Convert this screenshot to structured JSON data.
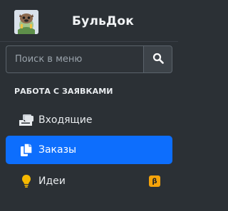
{
  "brand": {
    "name": "БульДок",
    "logo_icon": "bulldog-logo-icon"
  },
  "search": {
    "placeholder": "Поиск в меню",
    "value": "",
    "button_icon": "search-icon"
  },
  "section": {
    "heading": "РАБОТА С ЗАЯВКАМИ"
  },
  "nav": {
    "items": [
      {
        "label": "Входящие",
        "icon": "inbox-stack-icon",
        "active": false
      },
      {
        "label": "Заказы",
        "icon": "documents-icon",
        "active": true
      },
      {
        "label": "Идеи",
        "icon": "lightbulb-icon",
        "active": false,
        "badge": "β"
      }
    ]
  },
  "colors": {
    "sidebar_bg": "#2b3035",
    "active_bg": "#0d6efd",
    "badge_bg": "#f5a30a",
    "idea_icon": "#f5b800"
  }
}
